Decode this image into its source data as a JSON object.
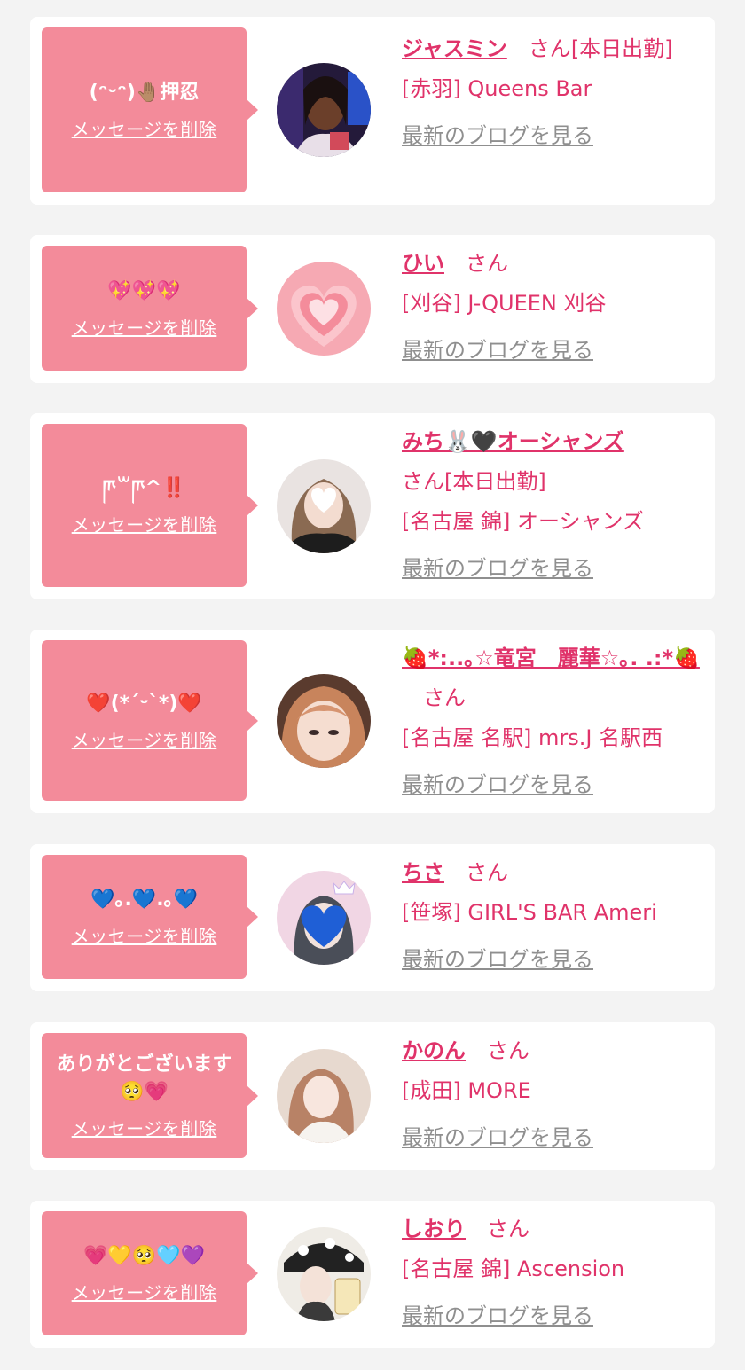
{
  "san_label": "さん",
  "delete_label": "メッセージを削除",
  "blog_label": "最新のブログを見る",
  "colors": {
    "accent": "#e0336a",
    "bubble": "#f38b9a",
    "link_gray": "#8f8f8f"
  },
  "items": [
    {
      "message": "(ᵔᵕᵔ)🤚🏽押忍",
      "name": "ジャスミン",
      "suffix": "[本日出勤]",
      "shop": "[赤羽] Queens Bar",
      "avatar_icon": "avatar-photo-icon"
    },
    {
      "message": "💖💖💖",
      "name": "ひい",
      "suffix": "",
      "shop": "[刈谷] J-QUEEN 刈谷",
      "avatar_icon": "pink-heart-avatar-icon"
    },
    {
      "message": "ཫ꒳ཫ^‼️",
      "name": "みち🐰🖤オーシャンズ",
      "suffix": "[本日出勤]",
      "shop": "[名古屋 錦] オーシャンズ",
      "avatar_icon": "avatar-photo-icon"
    },
    {
      "message": "❤️(*´ᵕ`*)❤️",
      "name": "🍓*:..｡☆竜宮　麗華☆｡. .:*🍓",
      "suffix": "",
      "shop": "[名古屋 名駅] mrs.J 名駅西",
      "avatar_icon": "avatar-photo-icon"
    },
    {
      "message": "💙｡.💙.｡💙",
      "name": "ちさ",
      "suffix": "",
      "shop": "[笹塚] GIRL'S BAR Ameri",
      "avatar_icon": "avatar-photo-icon"
    },
    {
      "message": "ありがとございます🥺💗",
      "name": "かのん",
      "suffix": "",
      "shop": "[成田] MORE",
      "avatar_icon": "avatar-photo-icon"
    },
    {
      "message": "💗💛🥺🩵💜",
      "name": "しおり",
      "suffix": "",
      "shop": "[名古屋 錦] Ascension",
      "avatar_icon": "avatar-photo-icon"
    }
  ]
}
